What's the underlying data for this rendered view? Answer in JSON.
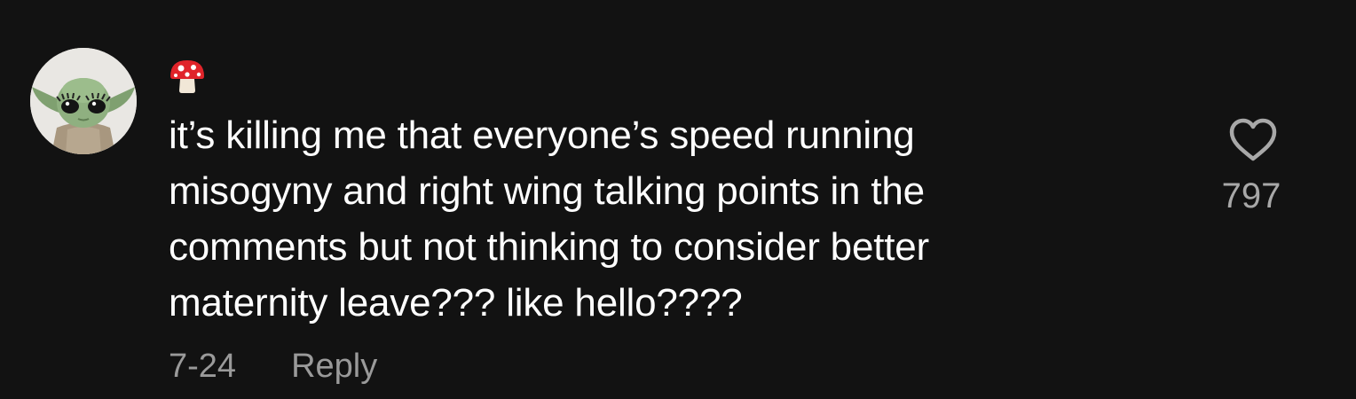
{
  "comment": {
    "avatar_icon": "baby-yoda-avatar",
    "username_icon": "mushroom-emoji",
    "text": "it’s killing me that everyone’s speed running\nmisogyny and right wing talking points in the\ncomments but not thinking to consider better\nmaternity leave??? like hello????",
    "date": "7-24",
    "reply_label": "Reply",
    "like_icon": "heart-outline-icon",
    "like_count": "797"
  },
  "colors": {
    "background": "#121212",
    "text": "#ffffff",
    "muted": "#9a9a9a"
  }
}
